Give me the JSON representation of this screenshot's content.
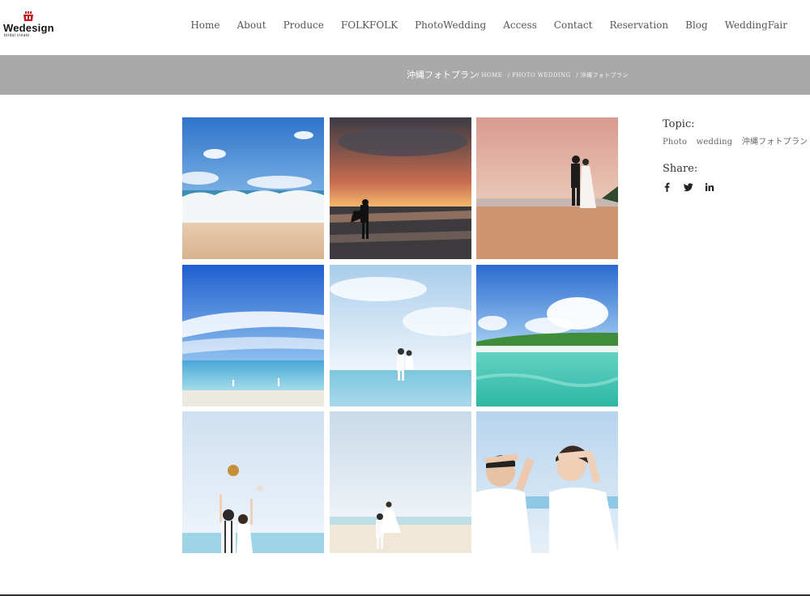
{
  "logo": {
    "text": "Wedesign",
    "sub": "bridal create"
  },
  "nav": {
    "items": [
      "Home",
      "About",
      "Produce",
      "FOLKFOLK",
      "PhotoWedding",
      "Access",
      "Contact",
      "Reservation",
      "Blog",
      "WeddingFair"
    ]
  },
  "titlebar": {
    "title": "沖縄フォトプラン",
    "crumbs": [
      "/ HOME",
      "/ PHOTO WEDDING",
      "/ 沖縄フォトプラン"
    ]
  },
  "sidebar": {
    "topic_heading": "Topic:",
    "topics": [
      "Photo",
      "wedding",
      "沖縄フォトプラン"
    ],
    "share_heading": "Share:",
    "share_icons": [
      "facebook-icon",
      "twitter-icon",
      "linkedin-icon"
    ]
  },
  "gallery": {
    "photos": [
      "beach-wave",
      "sunset-couple",
      "evening-beach-couple",
      "sky-ocean-horizon",
      "couple-in-sea",
      "island-lagoon",
      "hat-toss-couple",
      "lift-couple-beach",
      "couple-shading-eyes"
    ]
  }
}
